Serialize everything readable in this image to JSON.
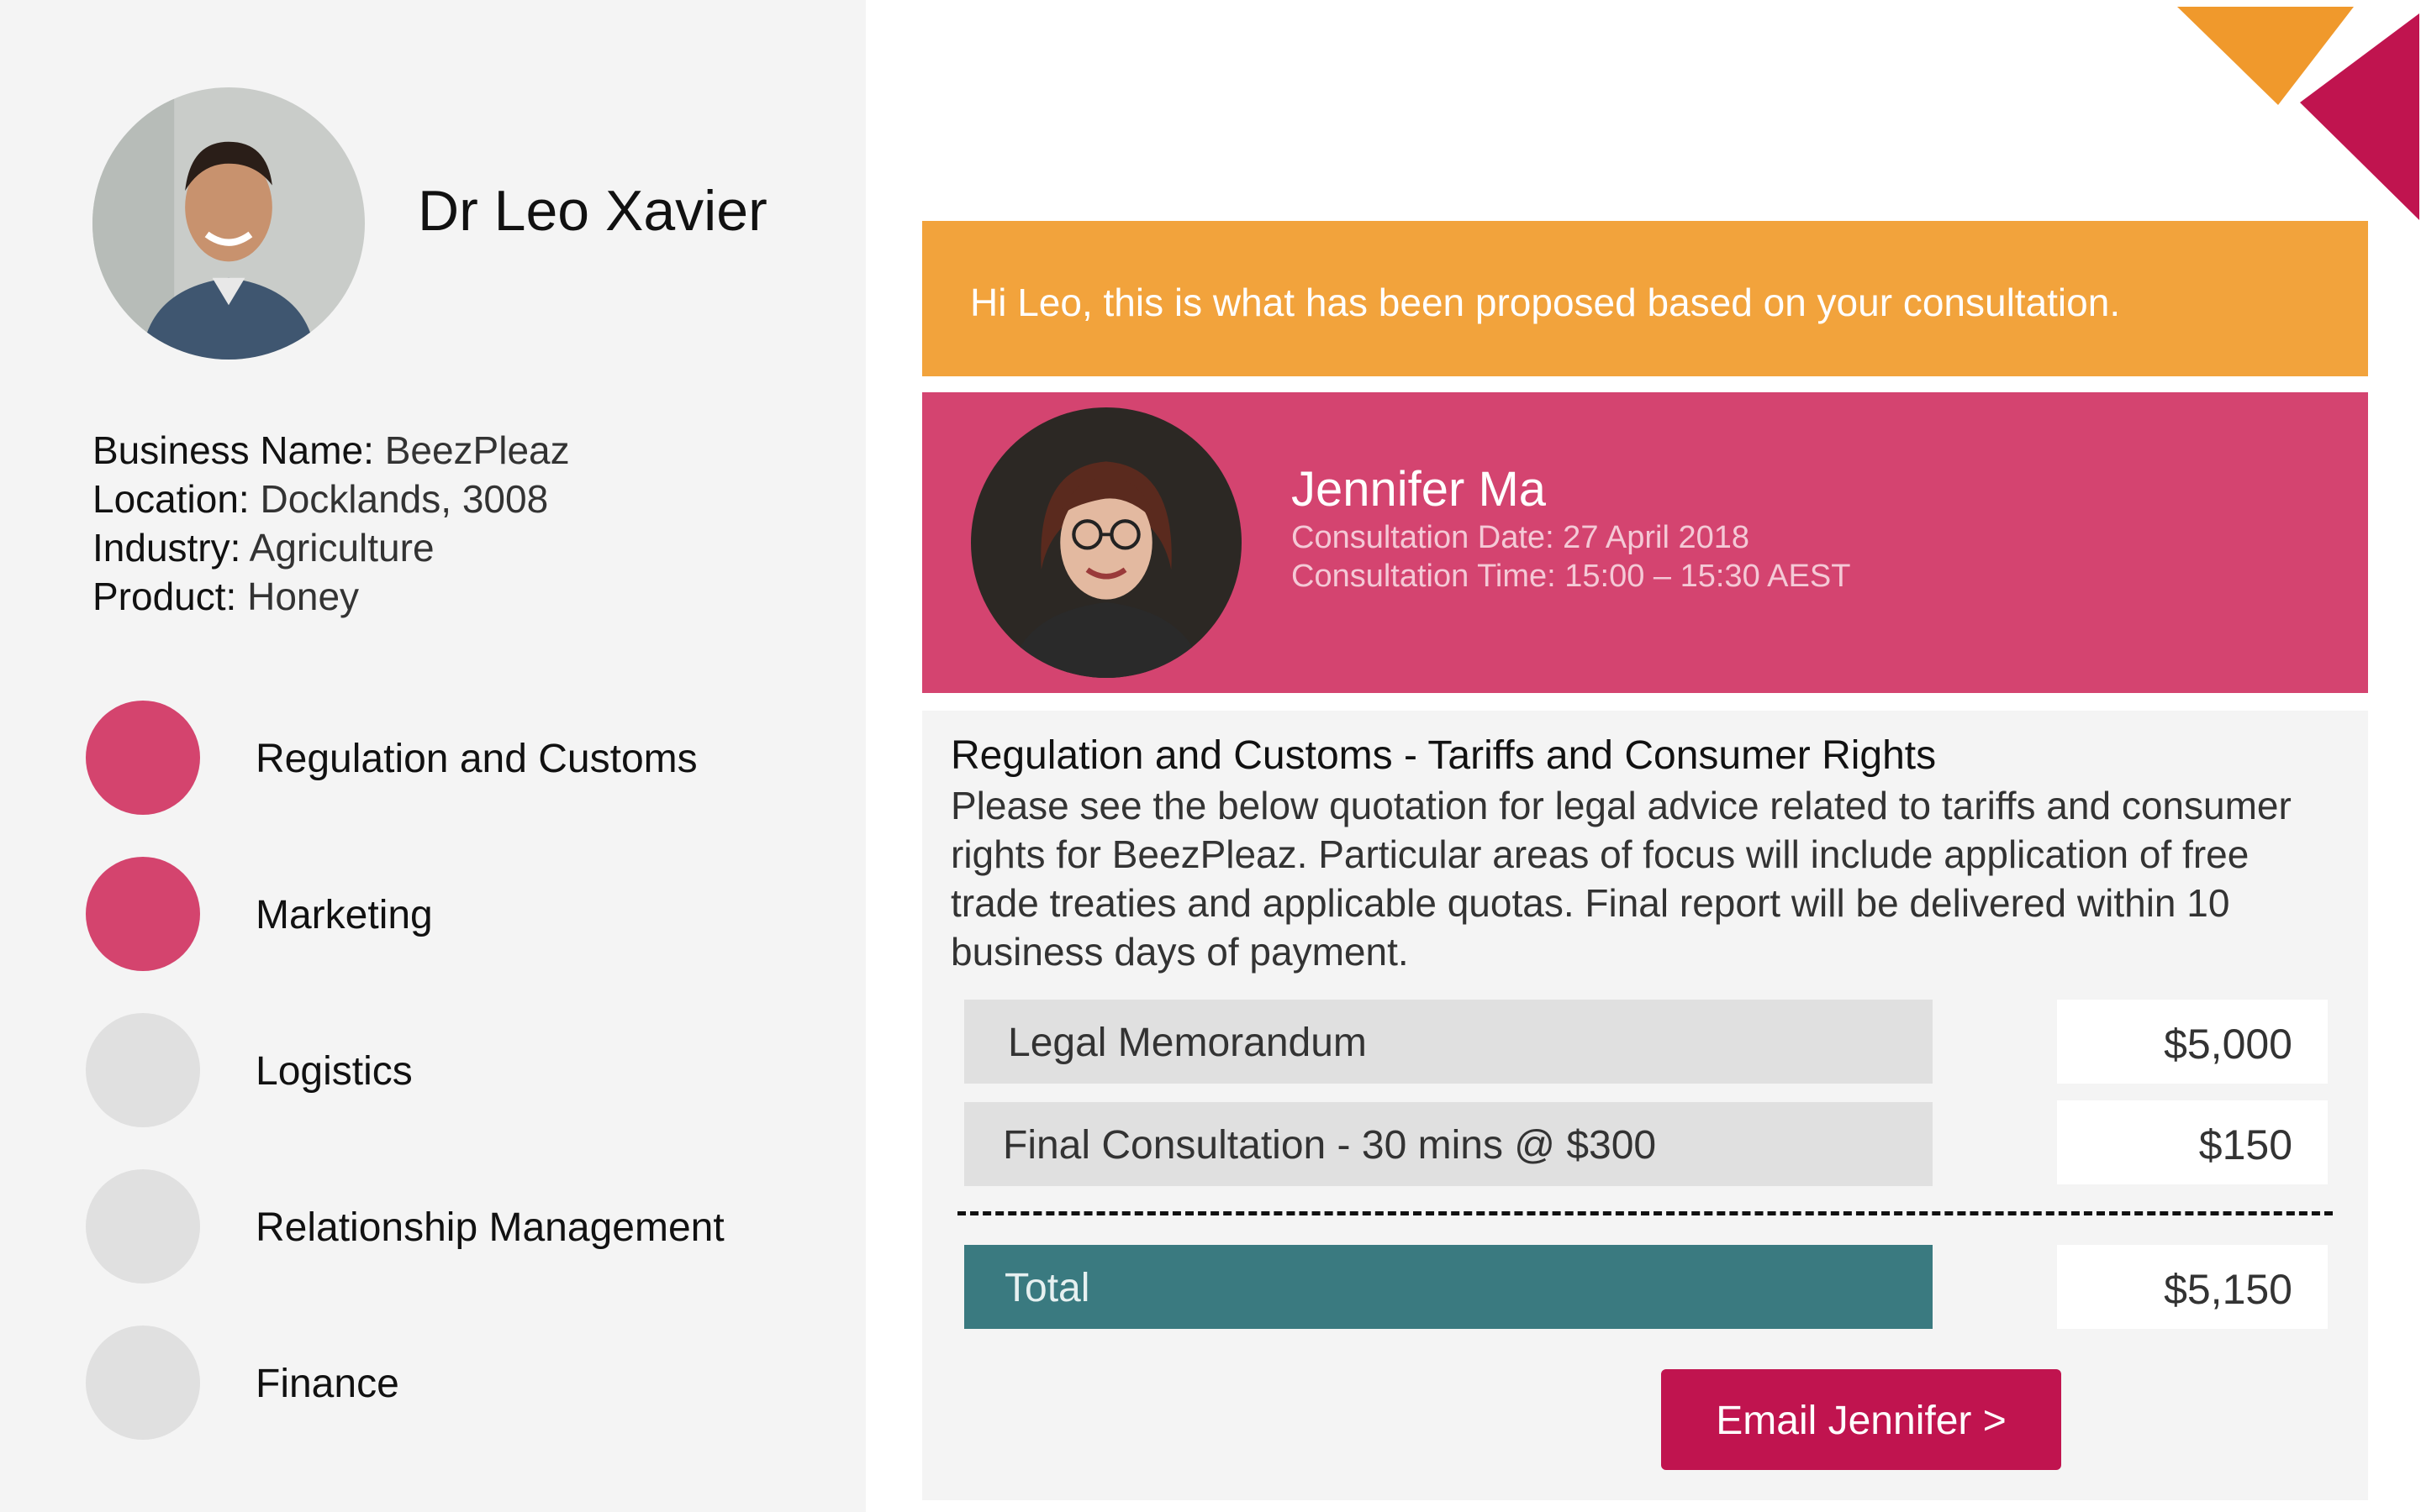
{
  "client": {
    "name": "Dr Leo Xavier",
    "details": [
      {
        "label": "Business Name:",
        "value": " BeezPleaz"
      },
      {
        "label": "Location:",
        "value": " Docklands, 3008"
      },
      {
        "label": "Industry:",
        "value": " Agriculture"
      },
      {
        "label": "Product:",
        "value": " Honey"
      }
    ]
  },
  "services": [
    {
      "label": "Regulation and Customs",
      "active": true
    },
    {
      "label": "Marketing",
      "active": true
    },
    {
      "label": "Logistics",
      "active": false
    },
    {
      "label": "Relationship Management",
      "active": false
    },
    {
      "label": "Finance",
      "active": false
    }
  ],
  "greeting": "Hi Leo, this is what has been proposed based on your consultation.",
  "consultant": {
    "name": "Jennifer Ma",
    "date": "Consultation Date: 27 April 2018",
    "time": "Consultation Time: 15:00 – 15:30 AEST"
  },
  "quote": {
    "title": "Regulation and Customs - Tariffs and Consumer Rights",
    "description": "Please see the below quotation for legal advice related to tariffs and consumer rights for BeezPleaz. Particular areas of focus will include application of free trade treaties and applicable quotas. Final report will be delivered within 10 business days of payment.",
    "items": [
      {
        "label": "Legal Memorandum",
        "price": "$5,000"
      },
      {
        "label": "Final Consultation - 30 mins @ $300",
        "price": "$150"
      }
    ],
    "total_label": "Total",
    "total_price": "$5,150"
  },
  "email_button": "Email Jennifer >",
  "colors": {
    "accent_pink": "#d44470",
    "accent_orange": "#f2a33c",
    "button_crimson": "#c0144f",
    "total_teal": "#3a7a80"
  }
}
